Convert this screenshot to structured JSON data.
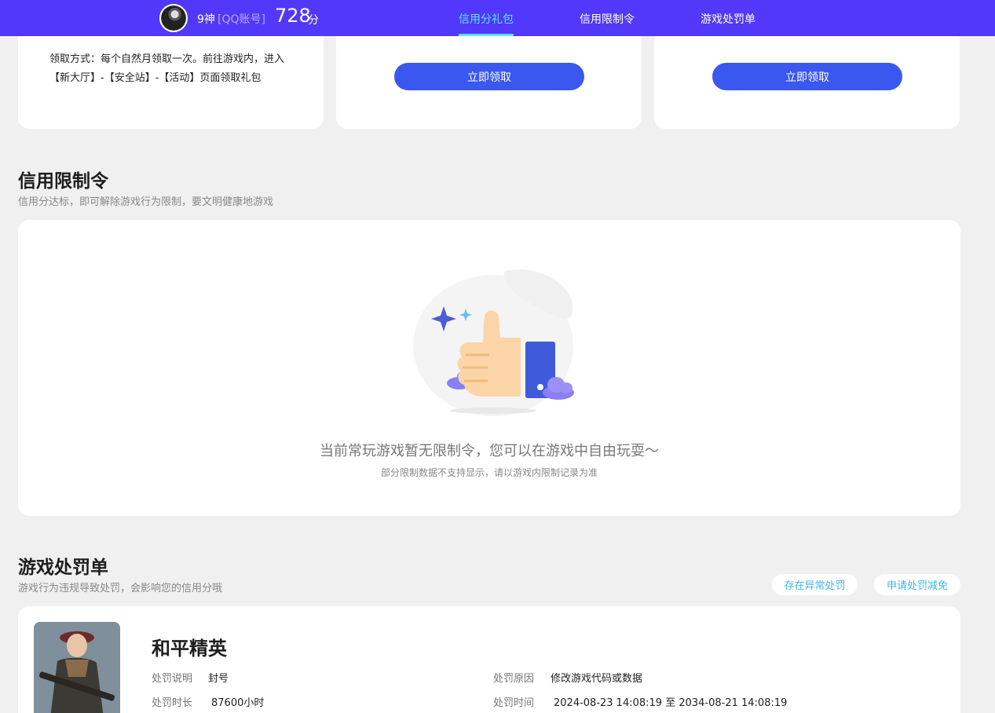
{
  "header": {
    "user_name": "9神",
    "account_type": "[QQ账号]",
    "score": "728",
    "score_unit": "分",
    "tabs": [
      {
        "label": "信用分礼包",
        "active": true
      },
      {
        "label": "信用限制令",
        "active": false
      },
      {
        "label": "游戏处罚单",
        "active": false
      }
    ]
  },
  "gifts": {
    "claim_method": "领取方式：每个自然月领取一次。前往游戏内，进入【新大厅】-【安全站】-【活动】页面领取礼包",
    "claim_button_1": "立即领取",
    "claim_button_2": "立即领取"
  },
  "restriction": {
    "title": "信用限制令",
    "subtitle": "信用分达标，即可解除游戏行为限制，要文明健康地游戏",
    "empty_main": "当前常玩游戏暂无限制令，您可以在游戏中自由玩耍～",
    "empty_sub": "部分限制数据不支持显示，请以游戏内限制记录为准"
  },
  "penalty": {
    "title": "游戏处罚单",
    "subtitle": "游戏行为违规导致处罚，会影响您的信用分哦",
    "abnormal_button": "存在异常处罚",
    "appeal_button": "申请处罚减免",
    "game_name": "和平精英",
    "desc_label": "处罚说明",
    "desc_value": "封号",
    "duration_label": "处罚时长",
    "duration_value": "87600小时",
    "reason_label": "处罚原因",
    "reason_value": "修改游戏代码或数据",
    "time_label": "处罚时间",
    "time_value": "2024-08-23 14:08:19 至 2034-08-21 14:08:19"
  },
  "colors": {
    "nav_bg": "#5138fb",
    "active_tab": "#5fe3ff",
    "button_blue": "#3a57f0",
    "pill_text": "#3fb6e8"
  }
}
